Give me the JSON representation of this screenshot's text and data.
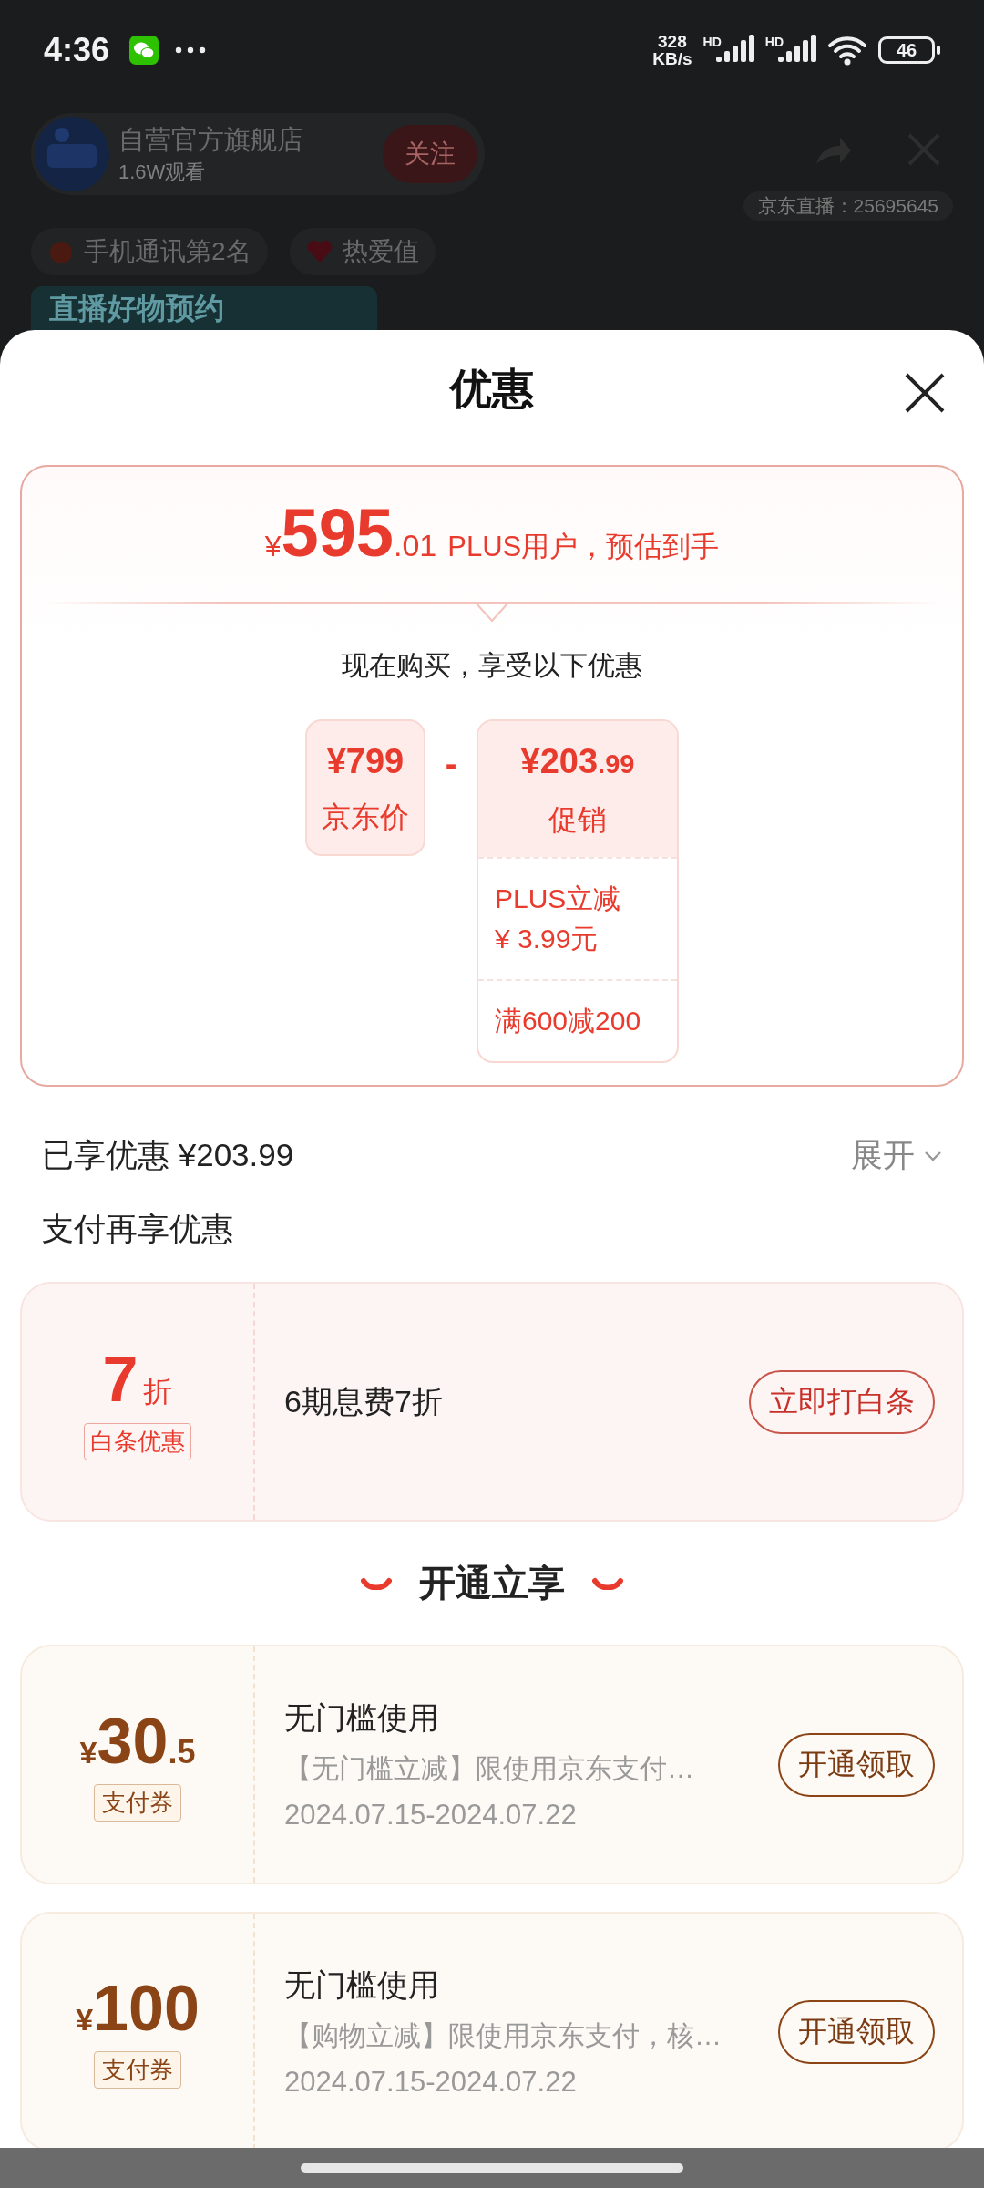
{
  "status_bar": {
    "time": "4:36",
    "net_speed": "328",
    "net_unit": "KB/s",
    "signal_labels": [
      "HD",
      "HD"
    ],
    "battery": "46"
  },
  "live_room": {
    "store_name": "自营官方旗舰店",
    "viewers": "1.6W观看",
    "follow_button": "关注",
    "room_id": "京东直播：25695645",
    "tags": [
      "手机通讯第2名",
      "热爱值"
    ],
    "banner": "直播好物预约"
  },
  "sheet": {
    "title": "优惠",
    "estimate": {
      "currency": "¥",
      "integer": "595",
      "decimal": ".01",
      "note": "PLUS用户，预估到手",
      "intro": "现在购买，享受以下优惠",
      "base": {
        "price": "¥799",
        "label": "京东价"
      },
      "operator": "-",
      "discount": {
        "price_int": "¥203",
        "price_dec": ".99",
        "label": "促销",
        "details": [
          {
            "title": "PLUS立减",
            "amount": "¥ 3.99元"
          },
          {
            "title": "满600减200"
          }
        ]
      }
    },
    "enjoyed": {
      "label": "已享优惠 ¥203.99",
      "action": "展开",
      "expanded": false
    },
    "pay_section": {
      "title": "支付再享优惠",
      "offers": [
        {
          "big": "7",
          "unit": "折",
          "tag": "白条优惠",
          "desc": "6期息费7折",
          "action": "立即打白条"
        }
      ]
    },
    "open_section": {
      "title": "开通立享",
      "coupons": [
        {
          "currency": "¥",
          "integer": "30",
          "decimal": ".5",
          "tag": "支付券",
          "title": "无门槛使用",
          "desc": "【无门槛立减】限使用京东支付…",
          "dates": "2024.07.15-2024.07.22",
          "action": "开通领取"
        },
        {
          "currency": "¥",
          "integer": "100",
          "tag": "支付券",
          "title": "无门槛使用",
          "desc": "【购物立减】限使用京东支付，核…",
          "dates": "2024.07.15-2024.07.22",
          "action": "开通领取"
        }
      ]
    }
  }
}
